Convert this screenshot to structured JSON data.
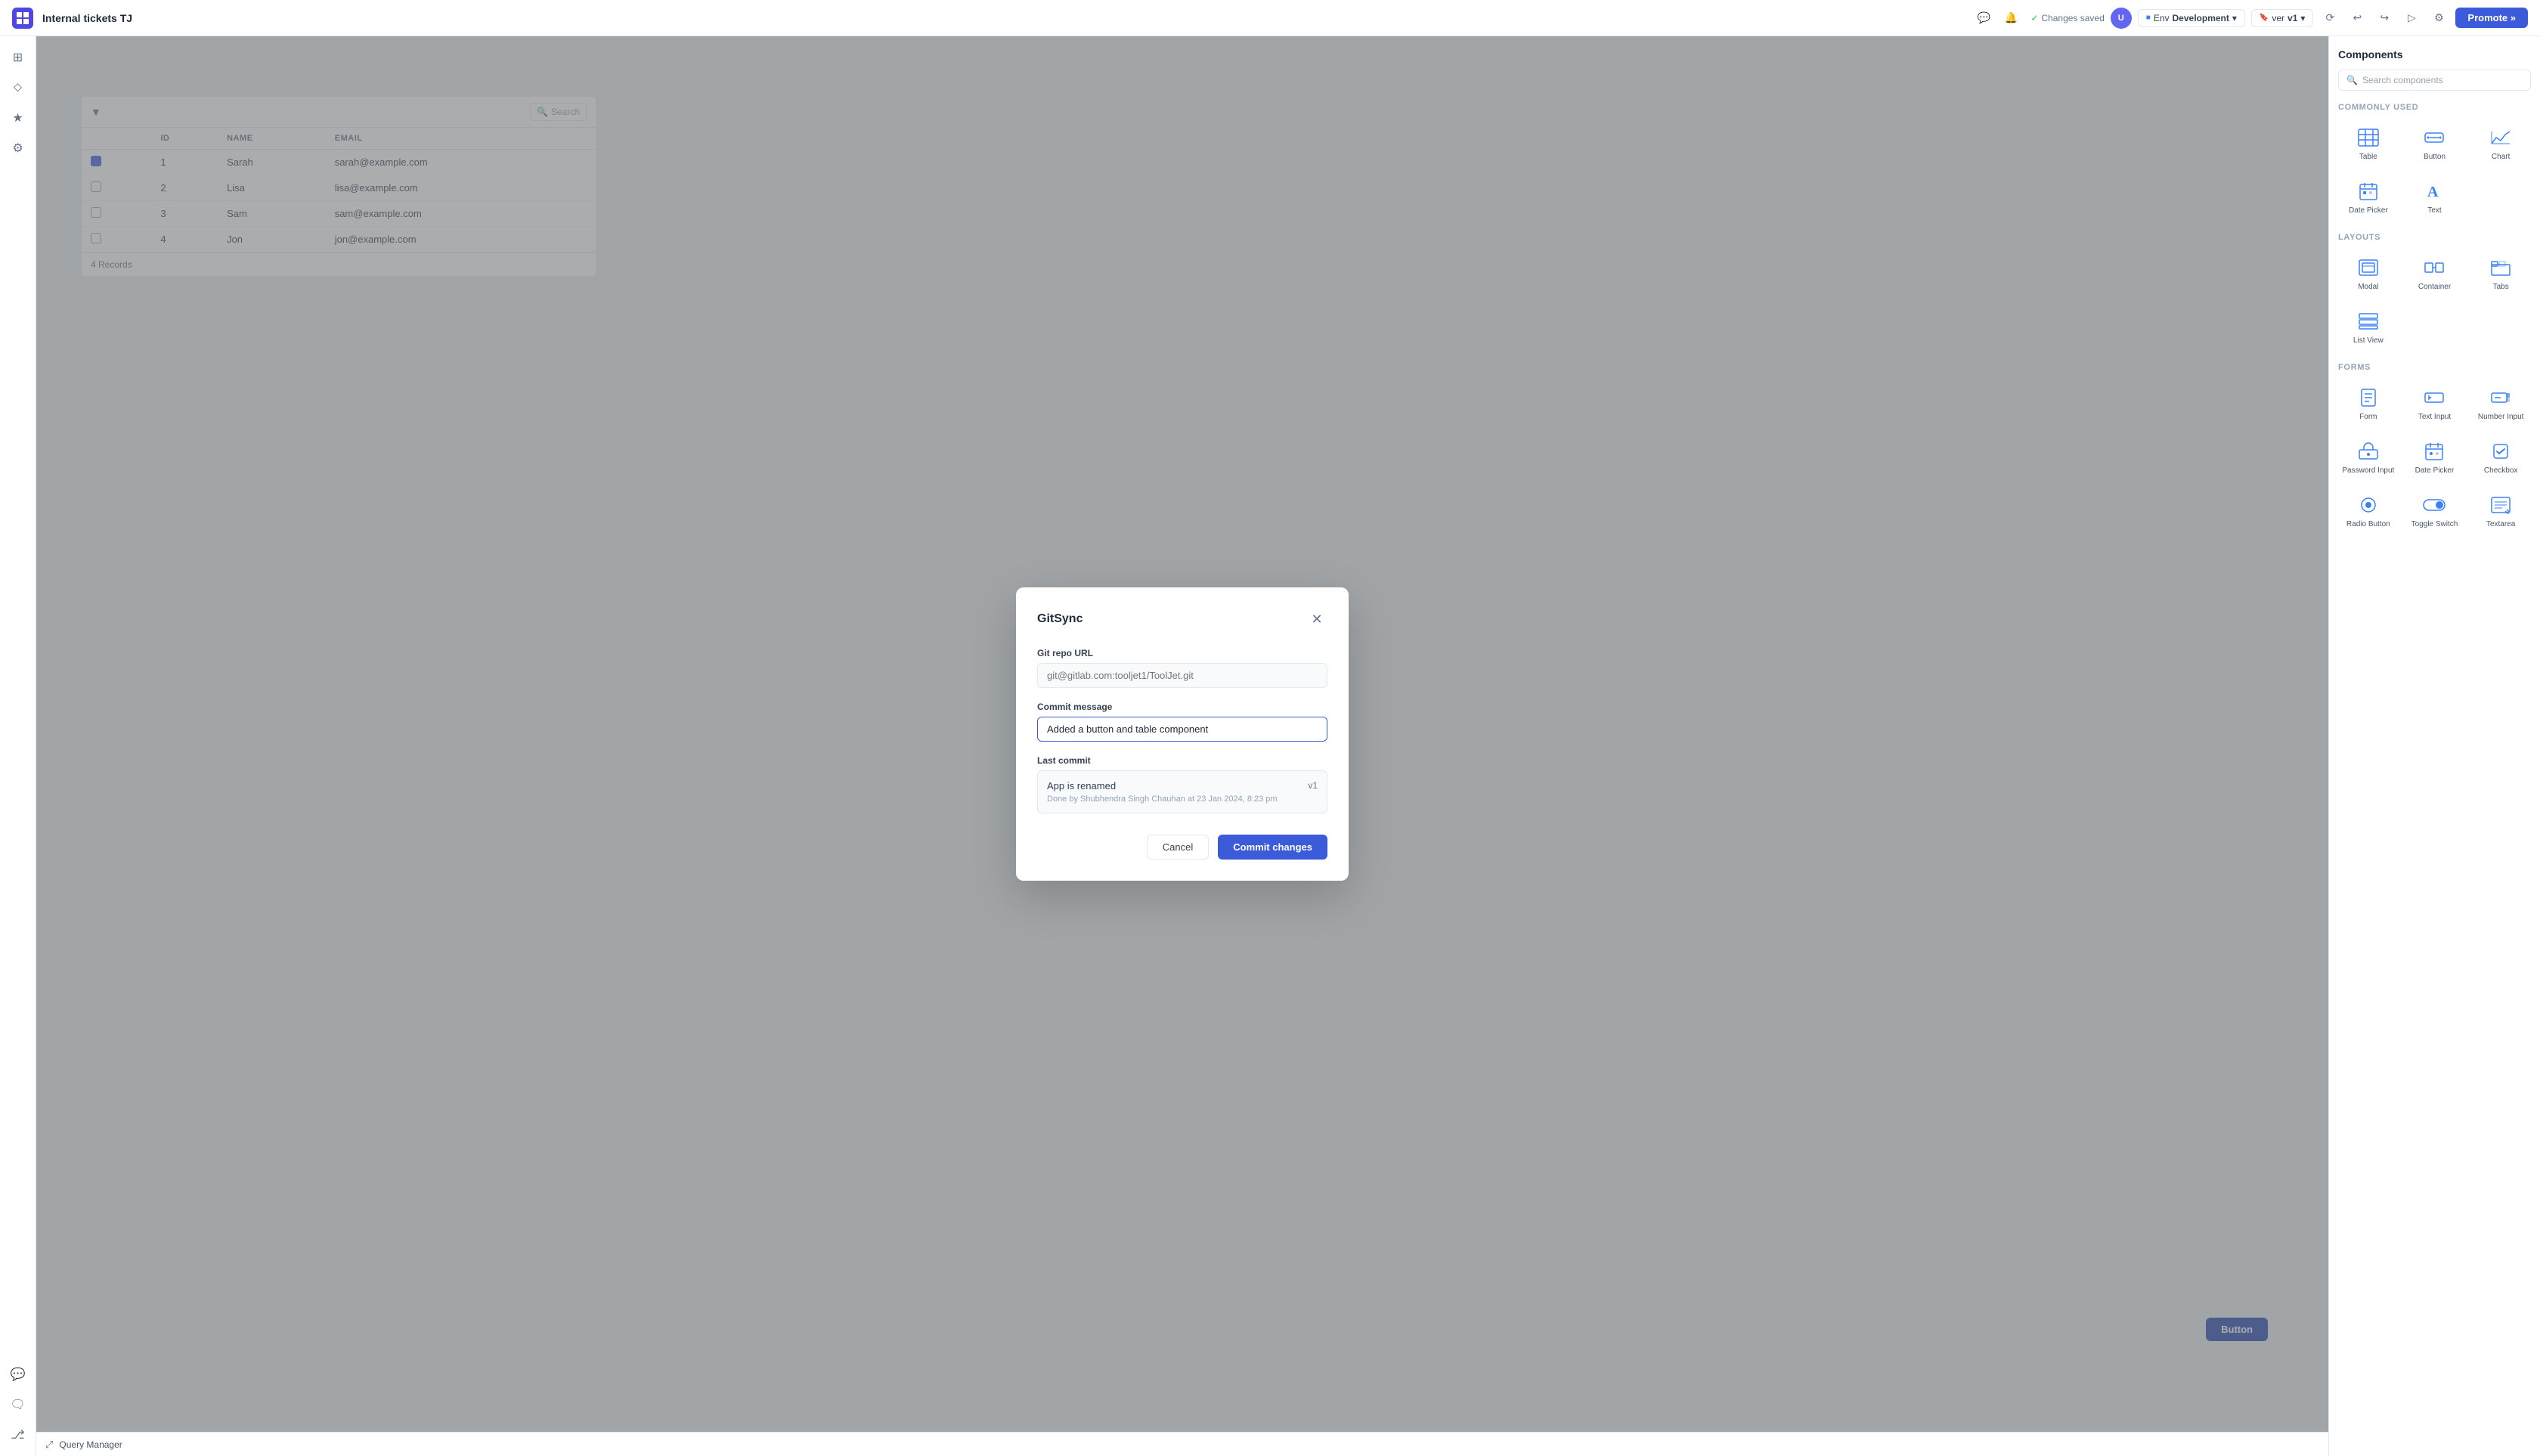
{
  "topbar": {
    "logo": "TJ",
    "title": "Internal tickets TJ",
    "status": "Changes saved",
    "env_label": "Env",
    "env_value": "Development",
    "ver_label": "ver",
    "ver_value": "v1",
    "promote_label": "Promote »"
  },
  "modal": {
    "title": "GitSync",
    "git_repo_url_label": "Git repo URL",
    "git_repo_url_placeholder": "git@gitlab.com:tooljet1/ToolJet.git",
    "commit_message_label": "Commit message",
    "commit_message_value": "Added a button and table component",
    "last_commit_label": "Last commit",
    "last_commit_message": "App is renamed",
    "last_commit_version": "v1",
    "last_commit_meta": "Done by Shubhendra Singh Chauhan at 23 Jan 2024, 8:23 pm",
    "cancel_label": "Cancel",
    "commit_label": "Commit changes"
  },
  "table": {
    "headers": [
      "",
      "ID",
      "NAME",
      "EMAIL"
    ],
    "rows": [
      {
        "id": "1",
        "name": "Sarah",
        "email": "sarah@example.com",
        "checked": true
      },
      {
        "id": "2",
        "name": "Lisa",
        "email": "lisa@example.com",
        "checked": false
      },
      {
        "id": "3",
        "name": "Sam",
        "email": "sam@example.com",
        "checked": false
      },
      {
        "id": "4",
        "name": "Jon",
        "email": "jon@example.com",
        "checked": false
      }
    ],
    "footer": "4 Records"
  },
  "components": {
    "title": "Components",
    "search_placeholder": "Search components",
    "commonly_used_label": "Commonly Used",
    "commonly_used": [
      {
        "name": "Table",
        "key": "table-component"
      },
      {
        "name": "Button",
        "key": "button-component"
      },
      {
        "name": "Chart",
        "key": "chart-component"
      },
      {
        "name": "Date Picker",
        "key": "date-picker-component"
      },
      {
        "name": "Text",
        "key": "text-component"
      }
    ],
    "layouts_label": "Layouts",
    "layouts": [
      {
        "name": "Modal",
        "key": "modal-component"
      },
      {
        "name": "Container",
        "key": "container-component"
      },
      {
        "name": "Tabs",
        "key": "tabs-component"
      },
      {
        "name": "List View",
        "key": "list-view-component"
      }
    ],
    "forms_label": "Forms",
    "forms": [
      {
        "name": "Form",
        "key": "form-component"
      },
      {
        "name": "Text Input",
        "key": "text-input-component"
      },
      {
        "name": "Number Input",
        "key": "number-input-component"
      },
      {
        "name": "Password Input",
        "key": "password-input-component"
      },
      {
        "name": "Date Picker",
        "key": "date-picker-form-component"
      },
      {
        "name": "Checkbox",
        "key": "checkbox-component"
      },
      {
        "name": "Radio Button",
        "key": "radio-button-component"
      },
      {
        "name": "Toggle Switch",
        "key": "toggle-switch-component"
      },
      {
        "name": "Textarea",
        "key": "textarea-component"
      }
    ]
  },
  "bottom_bar": {
    "query_manager_label": "Query Manager"
  }
}
